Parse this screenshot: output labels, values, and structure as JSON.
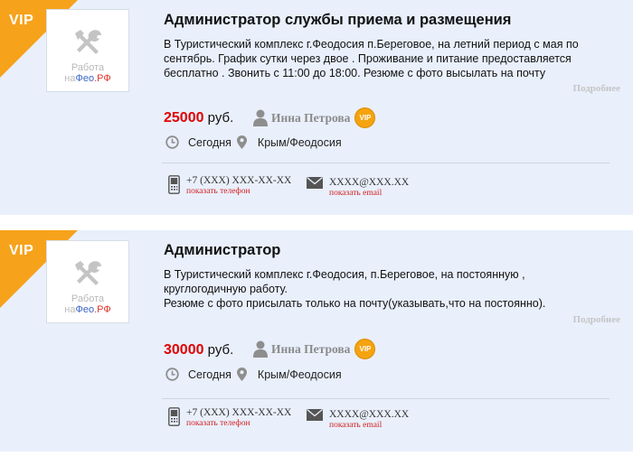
{
  "listings": [
    {
      "vip_ribbon": "VIP",
      "logo": {
        "line1": "Работа",
        "na": "на",
        "feo": "Фео",
        "rf": ".РФ"
      },
      "title": "Администратор службы приема и размещения",
      "description": [
        "В Туристический комплекс  г.Феодосия п.Береговое, на летний период с мая по сентябрь. График сутки через двое . Проживание и питание предоставляется бесплатно .  Звонить с 11:00 до 18:00.  Резюме с фото высылать на  почту"
      ],
      "more_link": "Подробнее",
      "salary_amount": "25000",
      "salary_currency": "руб.",
      "user_name": "Инна Петрова",
      "user_badge": "VIP",
      "date": "Сегодня",
      "location": "Крым/Феодосия",
      "phone": "+7 (XXX) XXX-XX-XX",
      "phone_action": "показать телефон",
      "email": "XXXX@XXX.XX",
      "email_action": "показать email"
    },
    {
      "vip_ribbon": "VIP",
      "logo": {
        "line1": "Работа",
        "na": "на",
        "feo": "Фео",
        "rf": ".РФ"
      },
      "title": "Администратор",
      "description": [
        "В Туристический комплекс г.Феодосия, п.Береговое, на постоянную , круглогодичную работу.",
        "Резюме с фото присылать только на почту(указывать,что на постоянно)."
      ],
      "more_link": "Подробнее",
      "salary_amount": "30000",
      "salary_currency": "руб.",
      "user_name": "Инна Петрова",
      "user_badge": "VIP",
      "date": "Сегодня",
      "location": "Крым/Феодосия",
      "phone": "+7 (XXX) XXX-XX-XX",
      "phone_action": "показать телефон",
      "email": "XXXX@XXX.XX",
      "email_action": "показать email"
    }
  ],
  "colors": {
    "ribbon": "#f7a21b",
    "salary": "#e00000",
    "card_bg": "#e9f0fc",
    "action_link": "#d42020"
  },
  "icons": [
    "tools-icon",
    "user-icon",
    "clock-icon",
    "location-pin-icon",
    "phone-icon",
    "mail-icon"
  ]
}
